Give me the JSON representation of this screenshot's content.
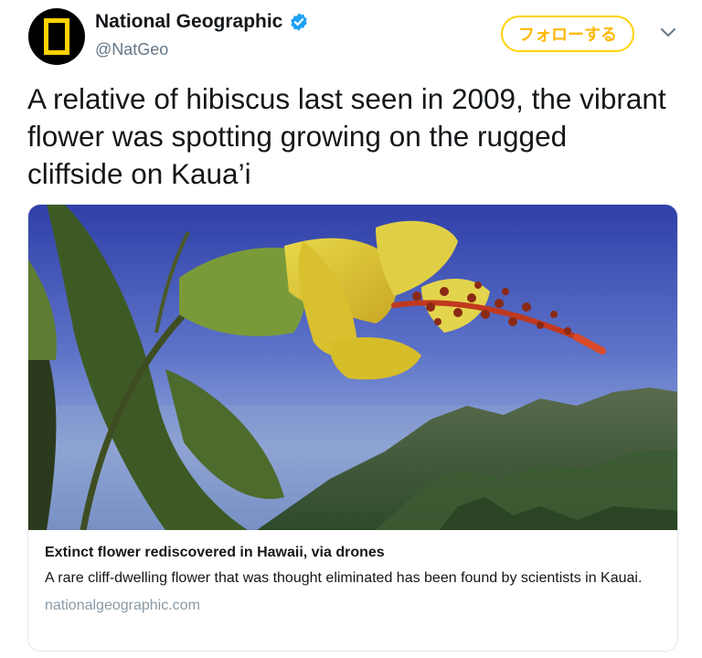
{
  "account": {
    "display_name": "National Geographic",
    "handle": "@NatGeo",
    "avatar_icon": "natgeo-yellow-frame-icon",
    "verified_icon": "verified-badge-icon",
    "verified_color": "#1da1f2"
  },
  "follow_button": {
    "label": "フォローする",
    "color": "#ffd200"
  },
  "menu_icon": "chevron-down-icon",
  "tweet": {
    "text": "A relative of hibiscus last seen in 2009, the vibrant flower was spotting growing on the rugged cliffside on Kaua’i"
  },
  "card": {
    "image_description": "yellow hibiscus-relative flower with red stamen in front of green cliffs and blue sky",
    "title": "Extinct flower rediscovered in Hawaii, via drones",
    "description": "A rare cliff-dwelling flower that was thought eliminated has been found by scientists in Kauai.",
    "domain": "nationalgeographic.com"
  }
}
